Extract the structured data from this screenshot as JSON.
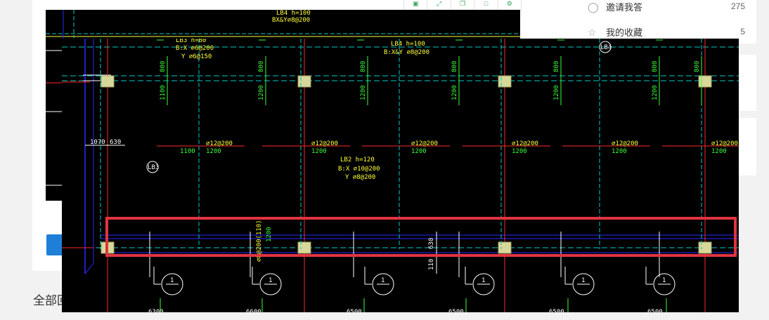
{
  "page": {
    "section_label": "全部回答"
  },
  "sidebar": {
    "items": [
      {
        "label": "邀请我答",
        "count": "275",
        "icon": "person-icon"
      },
      {
        "label": "我的收藏",
        "count": "5",
        "icon": "star-icon"
      }
    ]
  },
  "toolbar": {
    "buttons": [
      "save-icon",
      "expand-icon",
      "copy-icon",
      "window-icon",
      "gear-icon"
    ]
  },
  "drawing": {
    "back_labels": {
      "lb4": "LB4 h=100",
      "lb4_rebar": "BX&Y⌀8@200"
    },
    "slab_lb3": {
      "name": "LB3 h=80",
      "x": "B:X ⌀6@200",
      "y": "Y ⌀6@150"
    },
    "slab_lb4": {
      "name": "LB4 h=100",
      "rebar": "B:X&Y ⌀8@200"
    },
    "slab_lb2": {
      "name": "LB2 h=120",
      "x": "B:X ⌀10@200",
      "y": "Y ⌀8@200"
    },
    "tag_lb4": "LB4",
    "tag_lb3": "LB3",
    "dims_left": [
      "1070",
      "630"
    ],
    "top_bar_dims": [
      "800",
      "1100",
      "800",
      "1200",
      "800",
      "1200",
      "800",
      "1200",
      "800",
      "1200",
      "800",
      "1200",
      "800"
    ],
    "rebar_labels": [
      "⌀12@200",
      "⌀12@200",
      "⌀12@200",
      "⌀12@200",
      "⌀12@200",
      "⌀12@200",
      "⌀12@200"
    ],
    "rebar_lengths": [
      "1100",
      "1200",
      "1200",
      "1200",
      "1200",
      "1200",
      "1200"
    ],
    "bottom_rebar": "⌀8@200(110)",
    "bottom_len": "1200",
    "dim_630": "630",
    "dim_110": "110",
    "axis_marks": [
      "1",
      "1",
      "1",
      "1",
      "1",
      "1"
    ],
    "bottom_dims": [
      "6300",
      "6600",
      "6500",
      "6500",
      "6500",
      "6500"
    ]
  },
  "colors": {
    "accent": "#1e7fd8",
    "highlight": "#e0343f",
    "cad_bg": "#000000",
    "cad_yellow": "#ffff3c",
    "cad_green": "#3cff3c",
    "cad_cyan": "#00c8c8",
    "cad_blue": "#2828ff",
    "cad_red": "#ff2828"
  }
}
